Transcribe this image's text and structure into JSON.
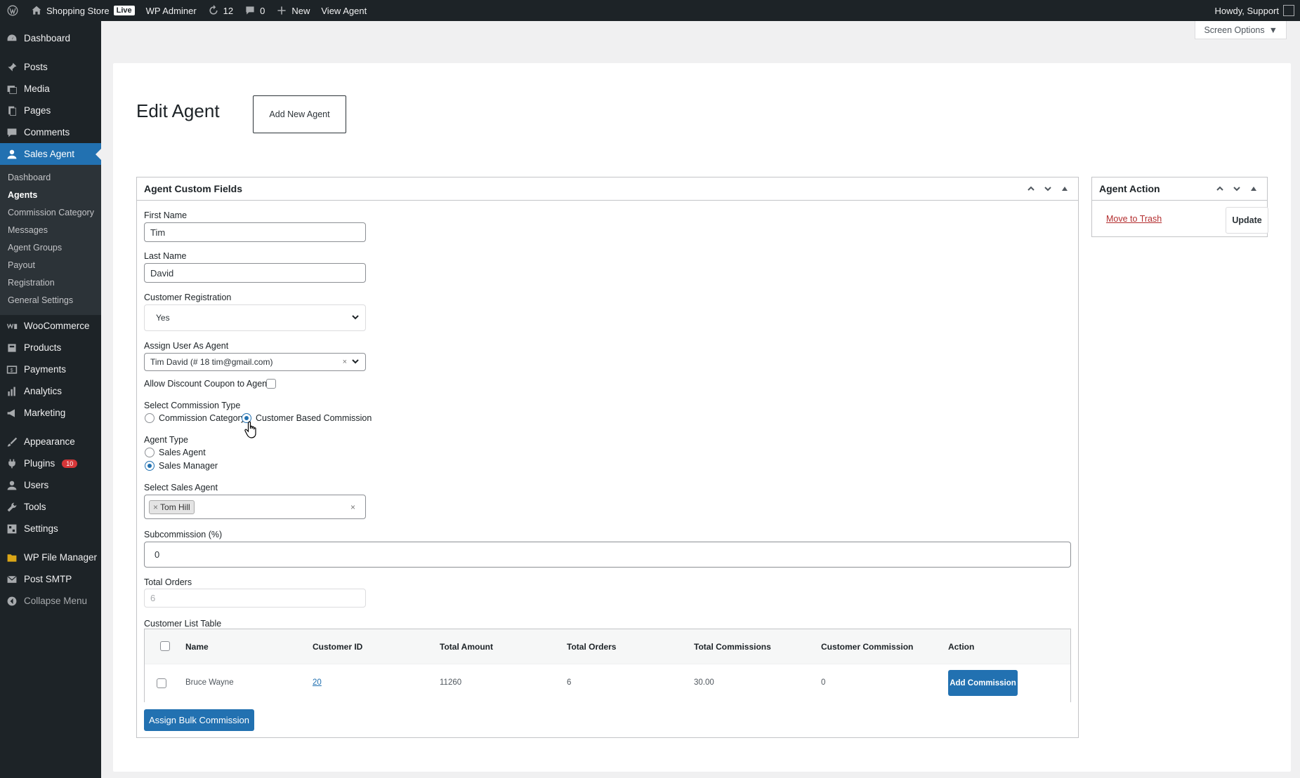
{
  "adminbar": {
    "site_name": "Shopping Store",
    "live_badge": "Live",
    "wp_admin": "WP Adminer",
    "updates_count": "12",
    "comments_count": "0",
    "new_label": "New",
    "view_agent": "View Agent",
    "howdy": "Howdy, Support"
  },
  "screen_options": "Screen Options",
  "sidebar": {
    "top_items": [
      {
        "label": "Dashboard",
        "icon": "dashboard-icon"
      },
      {
        "label": "Posts",
        "icon": "pin-icon"
      },
      {
        "label": "Media",
        "icon": "media-icon"
      },
      {
        "label": "Pages",
        "icon": "pages-icon"
      },
      {
        "label": "Comments",
        "icon": "comment-icon"
      },
      {
        "label": "Sales Agent",
        "icon": "user-icon"
      }
    ],
    "sub_items": [
      "Dashboard",
      "Agents",
      "Commission Category",
      "Messages",
      "Agent Groups",
      "Payout",
      "Registration",
      "General Settings"
    ],
    "woo_items": [
      {
        "label": "WooCommerce",
        "icon": "woo-icon"
      },
      {
        "label": "Products",
        "icon": "products-icon"
      },
      {
        "label": "Payments",
        "icon": "payments-icon"
      },
      {
        "label": "Analytics",
        "icon": "analytics-icon"
      },
      {
        "label": "Marketing",
        "icon": "megaphone-icon"
      }
    ],
    "admin_items": [
      {
        "label": "Appearance",
        "icon": "brush-icon"
      },
      {
        "label": "Plugins",
        "icon": "plugin-icon",
        "badge": "10"
      },
      {
        "label": "Users",
        "icon": "users-icon"
      },
      {
        "label": "Tools",
        "icon": "wrench-icon"
      },
      {
        "label": "Settings",
        "icon": "settings-icon"
      }
    ],
    "extra_items": [
      {
        "label": "WP File Manager",
        "icon": "folder-icon"
      },
      {
        "label": "Post SMTP",
        "icon": "mail-icon"
      }
    ],
    "collapse": "Collapse Menu"
  },
  "page": {
    "title": "Edit Agent",
    "add_new": "Add New Agent"
  },
  "custom_fields": {
    "title": "Agent Custom Fields",
    "first_name_label": "First Name",
    "first_name": "Tim",
    "last_name_label": "Last Name",
    "last_name": "David",
    "customer_registration_label": "Customer Registration",
    "customer_registration": "Yes",
    "assign_user_label": "Assign User As Agent",
    "assign_user": "Tim David (# 18 tim@gmail.com)",
    "allow_discount_label": "Allow Discount Coupon to Agent",
    "commission_type_label": "Select Commission Type",
    "commission_type_options": [
      "Commission Category",
      "Customer Based Commission"
    ],
    "agent_type_label": "Agent Type",
    "agent_type_options": [
      "Sales Agent",
      "Sales Manager"
    ],
    "select_sales_agent_label": "Select Sales Agent",
    "selected_sales_agent": "Tom Hill",
    "subcommission_label": "Subcommission (%)",
    "subcommission": "0",
    "total_orders_label": "Total Orders",
    "total_orders_placeholder": "6",
    "customer_list_label": "Customer List Table"
  },
  "customer_table": {
    "headers": [
      "Name",
      "Customer ID",
      "Total Amount",
      "Total Orders",
      "Total Commissions",
      "Customer Commission",
      "Action"
    ],
    "rows": [
      {
        "name": "Bruce Wayne",
        "customer_id": "20",
        "total_amount": "11260",
        "total_orders": "6",
        "total_commissions": "30.00",
        "customer_commission": "0",
        "action": "Add Commission"
      }
    ]
  },
  "bulk_button": "Assign Bulk Commission",
  "agent_action": {
    "title": "Agent Action",
    "trash": "Move to Trash",
    "update": "Update"
  },
  "colors": {
    "primary": "#2271b1",
    "sidebar_bg": "#1d2327",
    "danger": "#b32d2e"
  }
}
